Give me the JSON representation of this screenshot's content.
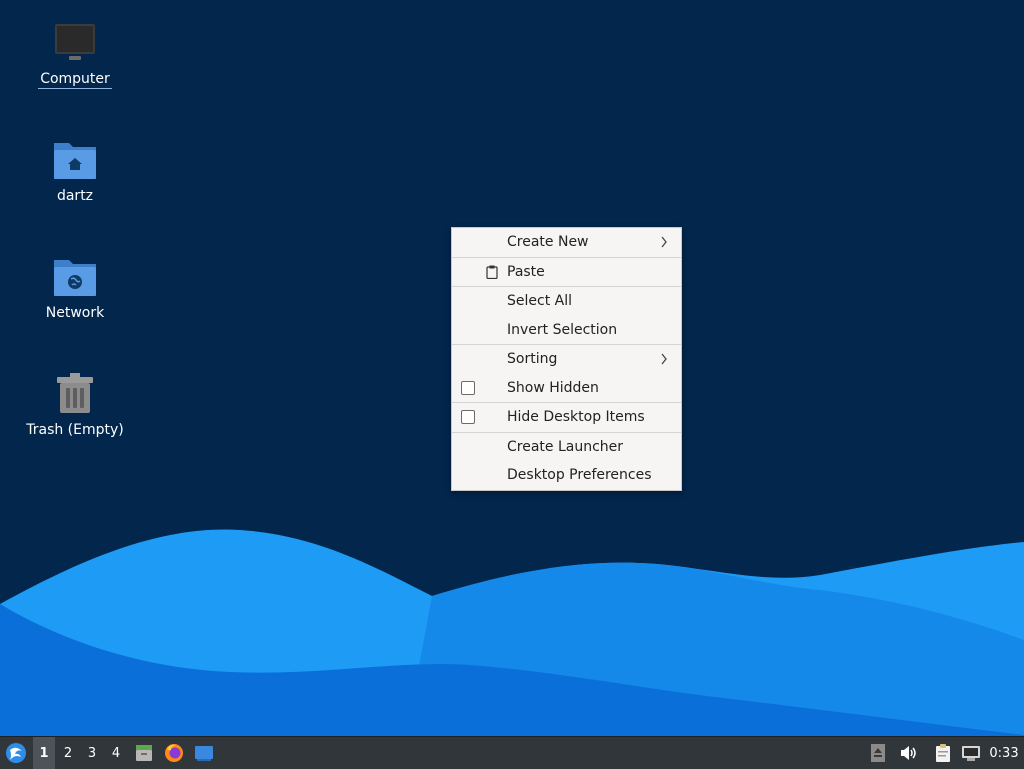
{
  "desktop": {
    "icons": [
      {
        "label": "Computer",
        "icon": "computer-icon"
      },
      {
        "label": "dartz",
        "icon": "home-folder-icon"
      },
      {
        "label": "Network",
        "icon": "network-folder-icon"
      },
      {
        "label": "Trash (Empty)",
        "icon": "trash-icon"
      }
    ]
  },
  "context_menu": {
    "items": [
      {
        "label": "Create New",
        "submenu": true
      },
      {
        "label": "Paste",
        "icon": "paste-icon"
      },
      {
        "label": "Select All"
      },
      {
        "label": "Invert Selection"
      },
      {
        "label": "Sorting",
        "submenu": true
      },
      {
        "label": "Show Hidden",
        "checkbox": false
      },
      {
        "label": "Hide Desktop Items",
        "checkbox": false
      },
      {
        "label": "Create Launcher"
      },
      {
        "label": "Desktop Preferences"
      }
    ]
  },
  "taskbar": {
    "workspaces": [
      "1",
      "2",
      "3",
      "4"
    ],
    "active_workspace": "1",
    "launchers": [
      "file-manager-icon",
      "firefox-icon",
      "show-desktop-icon"
    ],
    "tray": [
      "eject-icon",
      "volume-icon",
      "clipboard-icon",
      "network-icon"
    ],
    "clock": "0:33"
  },
  "colors": {
    "sky": "#02264c",
    "wave_light": "#1d9bf5",
    "wave_dark": "#0a6fd9",
    "taskbar": "#31363b"
  }
}
